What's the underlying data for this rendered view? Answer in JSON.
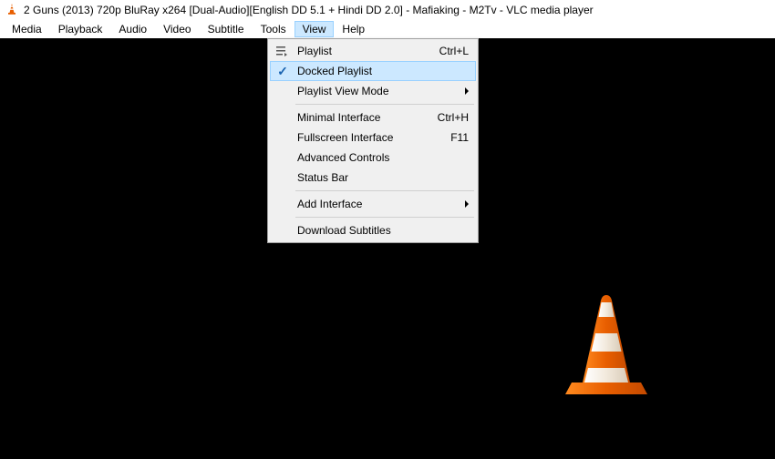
{
  "titlebar": {
    "title": "2 Guns (2013) 720p BluRay x264 [Dual-Audio][English DD 5.1 + Hindi DD 2.0] - Mafiaking - M2Tv - VLC media player"
  },
  "menubar": {
    "items": [
      {
        "label": "Media"
      },
      {
        "label": "Playback"
      },
      {
        "label": "Audio"
      },
      {
        "label": "Video"
      },
      {
        "label": "Subtitle"
      },
      {
        "label": "Tools"
      },
      {
        "label": "View"
      },
      {
        "label": "Help"
      }
    ],
    "active_index": 6
  },
  "dropdown": {
    "items": [
      {
        "label": "Playlist",
        "shortcut": "Ctrl+L",
        "icon": "playlist",
        "type": "item"
      },
      {
        "label": "Docked Playlist",
        "checked": true,
        "highlight": true,
        "type": "item"
      },
      {
        "label": "Playlist View Mode",
        "submenu": true,
        "type": "item"
      },
      {
        "type": "separator"
      },
      {
        "label": "Minimal Interface",
        "shortcut": "Ctrl+H",
        "type": "item"
      },
      {
        "label": "Fullscreen Interface",
        "shortcut": "F11",
        "type": "item"
      },
      {
        "label": "Advanced Controls",
        "type": "item"
      },
      {
        "label": "Status Bar",
        "type": "item"
      },
      {
        "type": "separator"
      },
      {
        "label": "Add Interface",
        "submenu": true,
        "type": "item"
      },
      {
        "type": "separator"
      },
      {
        "label": "Download Subtitles",
        "type": "item"
      }
    ]
  }
}
